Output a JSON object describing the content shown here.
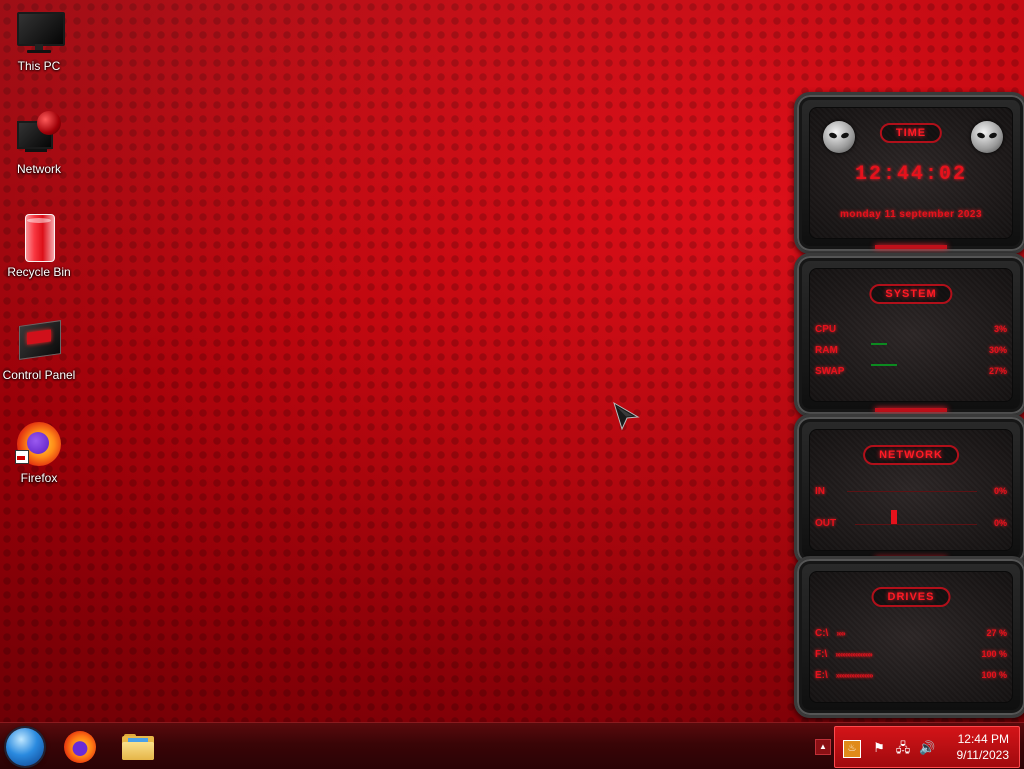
{
  "desktop": {
    "icons": [
      {
        "label": "This PC",
        "icon": "monitor-icon"
      },
      {
        "label": "Network",
        "icon": "network-icon"
      },
      {
        "label": "Recycle Bin",
        "icon": "recycle-bin-icon"
      },
      {
        "label": "Control Panel",
        "icon": "control-panel-icon"
      },
      {
        "label": "Firefox",
        "icon": "firefox-icon"
      }
    ]
  },
  "gadgets": {
    "time": {
      "title": "TIME",
      "clock": "12:44:02",
      "date": "monday 11 september 2023"
    },
    "system": {
      "title": "SYSTEM",
      "rows": [
        {
          "label": "CPU",
          "value": "3%"
        },
        {
          "label": "RAM",
          "value": "30%"
        },
        {
          "label": "SWAP",
          "value": "27%"
        }
      ]
    },
    "network": {
      "title": "NETWORK",
      "rows": [
        {
          "label": "IN",
          "value": "0%"
        },
        {
          "label": "OUT",
          "value": "0%"
        }
      ]
    },
    "drives": {
      "title": "DRIVES",
      "rows": [
        {
          "label": "C:\\",
          "value": "27 %",
          "fill": 0.27
        },
        {
          "label": "F:\\",
          "value": "100 %",
          "fill": 1.0
        },
        {
          "label": "E:\\",
          "value": "100 %",
          "fill": 1.0
        }
      ]
    }
  },
  "taskbar": {
    "start": "start-orb",
    "pinned": [
      {
        "name": "Firefox",
        "icon": "firefox-icon"
      },
      {
        "name": "File Explorer",
        "icon": "folder-icon"
      }
    ],
    "tray": {
      "time": "12:44 PM",
      "date": "9/11/2023"
    }
  },
  "colors": {
    "accent": "#e5121c",
    "tray": "#d41418",
    "taskbar": "#3a0507"
  }
}
